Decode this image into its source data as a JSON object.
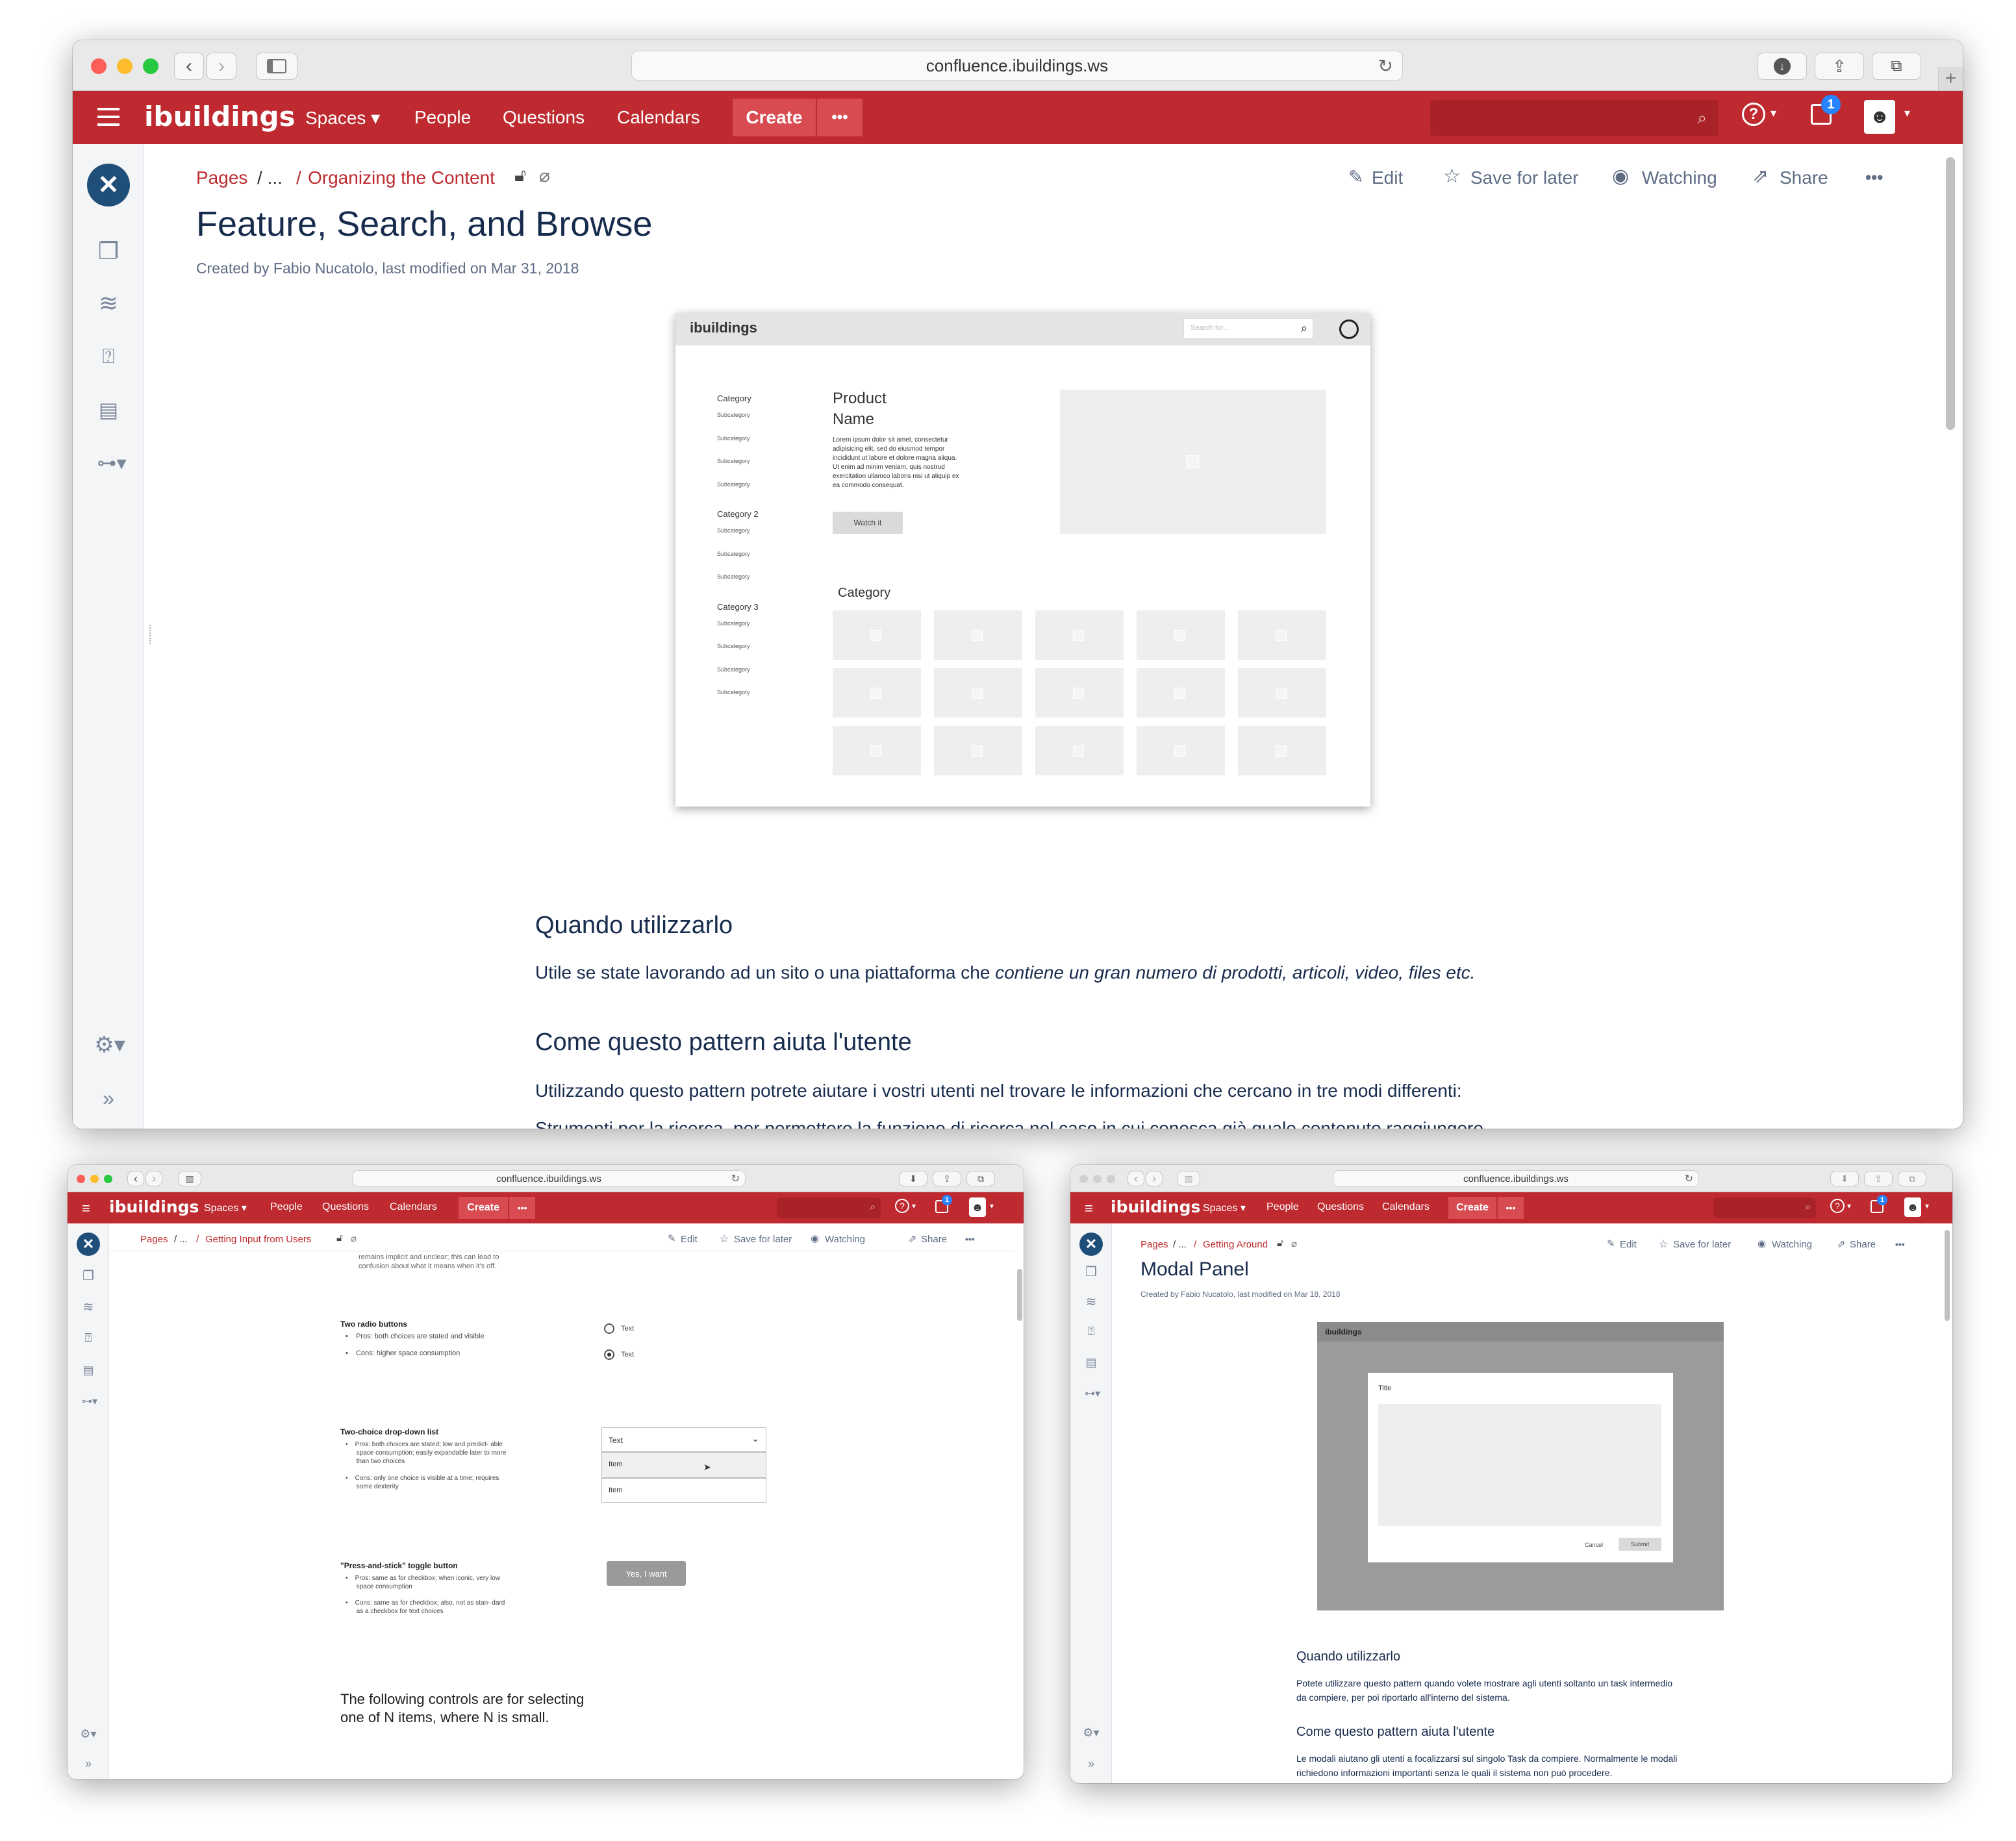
{
  "browser": {
    "url": "confluence.ibuildings.ws"
  },
  "nav": {
    "logo": "ibuildings",
    "spaces": "Spaces ▾",
    "people": "People",
    "questions": "Questions",
    "calendars": "Calendars",
    "create": "Create",
    "more": "•••",
    "notification_count": "1",
    "help": "?"
  },
  "actions": {
    "edit": "Edit",
    "save_for_later": "Save for later",
    "watching": "Watching",
    "share": "Share",
    "more": "•••"
  },
  "main": {
    "breadcrumb": {
      "pages": "Pages",
      "ellipsis": "/ ...",
      "sep": "/",
      "parent": "Organizing the Content"
    },
    "title": "Feature, Search, and Browse",
    "meta": "Created by Fabio Nucatolo, last modified on Mar 31, 2018",
    "mockup": {
      "logo": "ibuildings",
      "search_placeholder": "Search for...",
      "categories": [
        {
          "label": "Category",
          "subs": [
            "Subcategory",
            "Subcategory",
            "Subcategory",
            "Subcategory"
          ]
        },
        {
          "label": "Category 2",
          "subs": [
            "Subcategory",
            "Subcategory",
            "Subcategory"
          ]
        },
        {
          "label": "Category 3",
          "subs": [
            "Subcategory",
            "Subcategory",
            "Subcategory",
            "Subcategory"
          ]
        }
      ],
      "product_name_1": "Product",
      "product_name_2": "Name",
      "lorem": [
        "Lorem ipsum dolor sit amet, consectetur",
        "adipisicing elit, sed do eiusmod tempor",
        "incididunt ut labore et dolore magna aliqua.",
        "Ut enim ad minim veniam, quis nostrud",
        "exercitation ullamco laboris nisi ut aliquip ex",
        "ea commodo consequat."
      ],
      "watch_button": "Watch it",
      "grid_heading": "Category"
    },
    "h2_when": "Quando utilizzarlo",
    "p_when_a": "Utile se state lavorando ad un sito o una piattaforma che ",
    "p_when_b": "contiene un gran numero di prodotti, articoli, video, files etc.",
    "h2_how": "Come questo pattern aiuta l'utente",
    "p_how": "Utilizzando questo pattern potrete aiutare i vostri utenti nel trovare le informazioni che cercano in tre modi differenti:",
    "p_cut": "Strumenti per la ricerca, per permettere la funzione di ricerca nel caso in cui conosca già quale contenuto raggiungere."
  },
  "left": {
    "breadcrumb": {
      "pages": "Pages",
      "ellipsis": "/ ...",
      "sep": "/",
      "parent": "Getting Input from Users"
    },
    "top_cut_1": "remains implicit and unclear; this can lead to",
    "top_cut_2": "confusion about what it means when it's off.",
    "radio_title": "Two radio buttons",
    "radio_pros": "Pros: both choices are stated and visible",
    "radio_cons": "Cons: higher space consumption",
    "radio_text": "Text",
    "dd_title": "Two-choice drop-down list",
    "dd_pros_1": "Pros: both choices are stated; low and predict- able",
    "dd_pros_2": "space consumption; easily expandable later to more",
    "dd_pros_3": "than two choices",
    "dd_cons_1": "Cons: only one choice is visible at a time; requires",
    "dd_cons_2": "some dexterity",
    "dd_value": "Text",
    "dd_item": "Item",
    "toggle_title": "\"Press-and-stick\" toggle button",
    "toggle_pros_1": "Pros: same as for checkbox; when iconic, very low",
    "toggle_pros_2": "space consumption",
    "toggle_cons_1": "Cons: same as for checkbox; also, not as stan- dard",
    "toggle_cons_2": "as a checkbox for text choices",
    "toggle_button": "Yes, I want",
    "closing_1": "The following controls are for selecting",
    "closing_2": "one of N items, where N is small."
  },
  "right": {
    "breadcrumb": {
      "pages": "Pages",
      "ellipsis": "/ ...",
      "sep": "/",
      "parent": "Getting Around"
    },
    "title": "Modal Panel",
    "meta": "Created by Fabio Nucatolo, last modified on Mar 18, 2018",
    "mock_logo": "ibuildings",
    "modal_title": "Title",
    "cancel": "Cancel",
    "submit": "Submit",
    "h_when": "Quando utilizzarlo",
    "p_when_1": "Potete utilizzare questo pattern quando volete mostrare agli utenti soltanto un task intermedio",
    "p_when_2": "da compiere, per poi riportarlo all'interno del sistema.",
    "h_how": "Come questo pattern aiuta l'utente",
    "p_how_1": "Le modali aiutano gli utenti a focalizzarsi sul singolo Task da compiere. Normalmente le modali",
    "p_how_2": "richiedono informazioni importanti senza le quali il sistema non può procedere."
  }
}
